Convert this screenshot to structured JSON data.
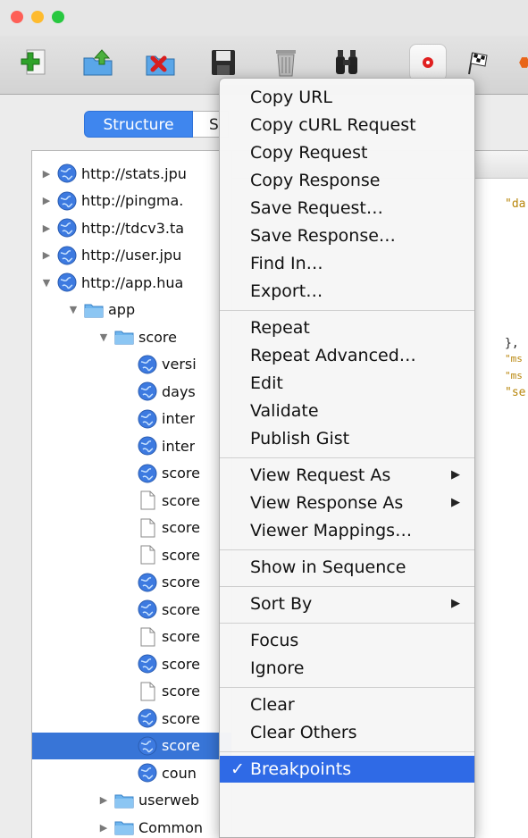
{
  "colors": {
    "close": "#fe5f57",
    "minimize": "#febb2e",
    "zoom": "#28c840",
    "selection": "#3875d7",
    "menu_highlight": "#2f6ae6",
    "code_string": "#b8860b"
  },
  "toolbar": {
    "buttons": [
      {
        "icon": "new-session-icon"
      },
      {
        "icon": "open-session-icon"
      },
      {
        "icon": "close-session-icon"
      },
      {
        "icon": "save-icon"
      },
      {
        "icon": "clear-trash-icon"
      },
      {
        "icon": "find-binoculars-icon"
      },
      {
        "icon": "record-icon"
      },
      {
        "icon": "throttle-flag-icon"
      }
    ]
  },
  "view_switch": {
    "structure": "Structure",
    "sequence": "S"
  },
  "tree": {
    "rows": [
      {
        "text": "http://stats.jpu",
        "icon": "globe",
        "disc": "closed",
        "level": 0
      },
      {
        "text": "http://pingma.",
        "icon": "globe",
        "disc": "closed",
        "level": 0
      },
      {
        "text": "http://tdcv3.ta",
        "icon": "globe",
        "disc": "closed",
        "level": 0
      },
      {
        "text": "http://user.jpu",
        "icon": "globe",
        "disc": "closed",
        "level": 0
      },
      {
        "text": "http://app.hua",
        "icon": "globe",
        "disc": "open",
        "level": 0
      },
      {
        "text": "app",
        "icon": "folder",
        "disc": "open",
        "level": 1
      },
      {
        "text": "score",
        "icon": "folder",
        "disc": "open",
        "level": 2
      },
      {
        "text": "versi",
        "icon": "globe",
        "disc": "none",
        "level": 3
      },
      {
        "text": "days",
        "icon": "globe",
        "disc": "none",
        "level": 3
      },
      {
        "text": "inter",
        "icon": "globe",
        "disc": "none",
        "level": 3
      },
      {
        "text": "inter",
        "icon": "globe",
        "disc": "none",
        "level": 3
      },
      {
        "text": "score",
        "icon": "globe",
        "disc": "none",
        "level": 3
      },
      {
        "text": "score",
        "icon": "doc",
        "disc": "none",
        "level": 3
      },
      {
        "text": "score",
        "icon": "doc",
        "disc": "none",
        "level": 3
      },
      {
        "text": "score",
        "icon": "doc",
        "disc": "none",
        "level": 3
      },
      {
        "text": "score",
        "icon": "globe",
        "disc": "none",
        "level": 3
      },
      {
        "text": "score",
        "icon": "globe",
        "disc": "none",
        "level": 3
      },
      {
        "text": "score",
        "icon": "doc",
        "disc": "none",
        "level": 3
      },
      {
        "text": "score",
        "icon": "globe",
        "disc": "none",
        "level": 3
      },
      {
        "text": "score",
        "icon": "doc",
        "disc": "none",
        "level": 3
      },
      {
        "text": "score",
        "icon": "globe",
        "disc": "none",
        "level": 3
      },
      {
        "text": "score",
        "icon": "globe",
        "disc": "none",
        "level": 3,
        "selected": true
      },
      {
        "text": "coun",
        "icon": "globe",
        "disc": "none",
        "level": 3
      },
      {
        "text": "userweb",
        "icon": "folder",
        "disc": "closed",
        "level": 2
      },
      {
        "text": "Common",
        "icon": "folder",
        "disc": "closed",
        "level": 2
      }
    ]
  },
  "content": {
    "line1": "\"da",
    "line2": "},",
    "line3": "\"ms",
    "line4": "\"ms",
    "line5": "\"se"
  },
  "menu": {
    "items": [
      {
        "label": "Copy URL",
        "name": "menu-item-copy-url"
      },
      {
        "label": "Copy cURL Request",
        "name": "menu-item-copy-curl-request"
      },
      {
        "label": "Copy Request",
        "name": "menu-item-copy-request"
      },
      {
        "label": "Copy Response",
        "name": "menu-item-copy-response"
      },
      {
        "label": "Save Request…",
        "name": "menu-item-save-request"
      },
      {
        "label": "Save Response…",
        "name": "menu-item-save-response"
      },
      {
        "label": "Find In…",
        "name": "menu-item-find-in"
      },
      {
        "label": "Export…",
        "name": "menu-item-export"
      },
      {
        "separator": true
      },
      {
        "label": "Repeat",
        "name": "menu-item-repeat"
      },
      {
        "label": "Repeat Advanced…",
        "name": "menu-item-repeat-advanced"
      },
      {
        "label": "Edit",
        "name": "menu-item-edit"
      },
      {
        "label": "Validate",
        "name": "menu-item-validate"
      },
      {
        "label": "Publish Gist",
        "name": "menu-item-publish-gist"
      },
      {
        "separator": true
      },
      {
        "label": "View Request As",
        "name": "menu-item-view-request-as",
        "submenu": true
      },
      {
        "label": "View Response As",
        "name": "menu-item-view-response-as",
        "submenu": true
      },
      {
        "label": "Viewer Mappings…",
        "name": "menu-item-viewer-mappings"
      },
      {
        "separator": true
      },
      {
        "label": "Show in Sequence",
        "name": "menu-item-show-in-sequence"
      },
      {
        "separator": true
      },
      {
        "label": "Sort By",
        "name": "menu-item-sort-by",
        "submenu": true
      },
      {
        "separator": true
      },
      {
        "label": "Focus",
        "name": "menu-item-focus"
      },
      {
        "label": "Ignore",
        "name": "menu-item-ignore"
      },
      {
        "separator": true
      },
      {
        "label": "Clear",
        "name": "menu-item-clear"
      },
      {
        "label": "Clear Others",
        "name": "menu-item-clear-others"
      },
      {
        "separator": true
      },
      {
        "label": "Breakpoints",
        "name": "menu-item-breakpoints",
        "checked": true,
        "highlighted": true
      }
    ]
  }
}
